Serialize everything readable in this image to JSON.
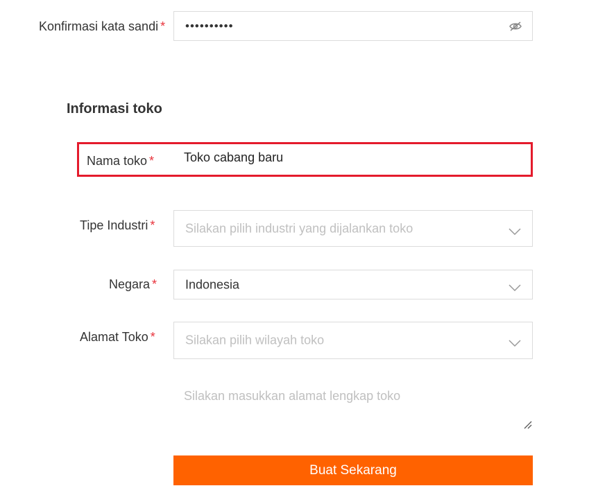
{
  "account": {
    "confirm_password_label": "Konfirmasi kata sandi",
    "confirm_password_value": "••••••••••",
    "required_mark": "*"
  },
  "store_section": {
    "title": "Informasi toko",
    "store_name_label": "Nama toko",
    "store_name_value": "Toko cabang baru",
    "industry_label": "Tipe Industri",
    "industry_placeholder": "Silakan pilih industri yang dijalankan toko",
    "country_label": "Negara",
    "country_value": "Indonesia",
    "address_label": "Alamat Toko",
    "region_placeholder": "Silakan pilih wilayah toko",
    "full_address_placeholder": "Silakan masukkan alamat lengkap toko"
  },
  "actions": {
    "submit_label": "Buat Sekarang"
  },
  "colors": {
    "accent": "#ff6200",
    "required": "#e8333c",
    "highlight": "#e41b2c",
    "border": "#dcdcdc",
    "placeholder": "#c0c0c0"
  },
  "icons": {
    "password_toggle": "eye-slash-icon",
    "dropdown": "chevron-down-icon",
    "textarea_resize": "resize-handle-icon"
  }
}
